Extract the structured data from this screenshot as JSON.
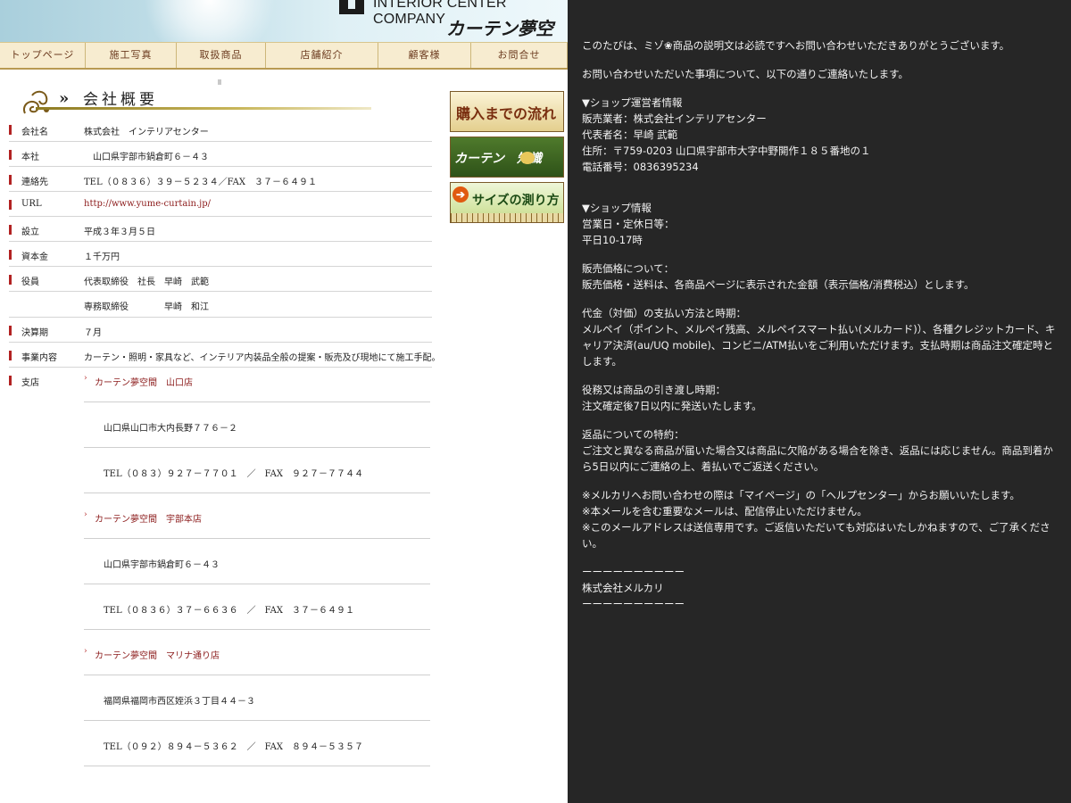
{
  "header": {
    "company_en": "INTERIOR CENTER COMPANY",
    "company_jp": "カーテン夢空間"
  },
  "nav": {
    "items": [
      {
        "label": "トップページ",
        "width": 96
      },
      {
        "label": "施工写真",
        "width": 102
      },
      {
        "label": "取扱商品",
        "width": 100
      },
      {
        "label": "店舗紹介",
        "width": 126
      },
      {
        "label": "顧客様",
        "width": 104
      },
      {
        "label": "お問合せ",
        "width": 108
      }
    ]
  },
  "company": {
    "title": "会社概要",
    "rows": [
      {
        "label": "会社名",
        "value": "株式会社　インテリアセンター"
      },
      {
        "label": "本社",
        "value": "　山口県宇部市鍋倉町６－４３"
      },
      {
        "label": "連絡先",
        "value": "TEL（０８３６）３９－５２３４／FAX　３７－６４９１"
      },
      {
        "label": "URL",
        "value": "http://www.yume-curtain.jp/"
      },
      {
        "label": "設立",
        "value": "平成３年３月５日"
      },
      {
        "label": "資本金",
        "value": "１千万円"
      },
      {
        "label": "役員",
        "value": "代表取締役　社長　早崎　武範"
      },
      {
        "label": "",
        "value": "専務取締役　　　　早崎　和江"
      },
      {
        "label": "決算期",
        "value": "７月"
      },
      {
        "label": "事業内容",
        "value": "カーテン・照明・家具など、インテリア内装品全般の提案・販売及び現地にて施工手配。"
      },
      {
        "label": "支店",
        "value": ""
      }
    ],
    "branches": [
      {
        "name": "カーテン夢空間　山口店",
        "address": "山口県山口市大内長野７７６－２",
        "contact": "TEL（０８３）９２７－７７０１　／　FAX　９２７－７７４４"
      },
      {
        "name": "カーテン夢空間　宇部本店",
        "address": "山口県宇部市鍋倉町６－４３",
        "contact": "TEL（０８３６）３７－６６３６　／　FAX　３７－６４９１"
      },
      {
        "name": "カーテン夢空間　マリナ通り店",
        "address": "福岡県福岡市西区姪浜３丁目４４－３",
        "contact": "TEL（０９２）８９４－５３６２　／　FAX　８９４－５３５７"
      }
    ]
  },
  "banners": {
    "flow": "購入までの流れ",
    "knowledge": "カーテン　知識",
    "measure": "サイズの測り方"
  },
  "message": {
    "greeting": "このたびは、ミゾ❀商品の説明文は必読ですへお問い合わせいただきありがとうございます。",
    "intro": "お問い合わせいただいた事項について、以下の通りご連絡いたします。",
    "operator_heading": "▼ショップ運営者情報",
    "operator_seller": "販売業者：株式会社インテリアセンター",
    "operator_rep": "代表者名：早崎 武範",
    "operator_address": "住所：〒759-0203 山口県宇部市大字中野開作１８５番地の１",
    "operator_phone": "電話番号：0836395234",
    "shop_heading": "▼ショップ情報",
    "shop_hours_label": "営業日・定休日等：",
    "shop_hours": "平日10-17時",
    "price_label": "販売価格について：",
    "price_text": "販売価格・送料は、各商品ページに表示された金額（表示価格/消費税込）とします。",
    "payment_label": "代金（対価）の支払い方法と時期：",
    "payment_text": "メルペイ（ポイント、メルペイ残高、メルペイスマート払い(メルカード)）、各種クレジットカード、キャリア決済(au/UQ mobile)、コンビニ/ATM払いをご利用いただけます。支払時期は商品注文確定時とします。",
    "delivery_label": "役務又は商品の引き渡し時期：",
    "delivery_text": "注文確定後7日以内に発送いたします。",
    "return_label": "返品についての特約：",
    "return_text": "ご注文と異なる商品が届いた場合又は商品に欠陥がある場合を除き、返品には応じません。商品到着から5日以内にご連絡の上、着払いでご返送ください。",
    "note1": "※メルカリへお問い合わせの際は「マイページ」の「ヘルプセンター」からお願いいたします。",
    "note2": "※本メールを含む重要なメールは、配信停止いただけません。",
    "note3": "※このメールアドレスは送信専用です。ご返信いただいても対応はいたしかねますので、ご了承ください。",
    "divider": "ーーーーーーーーーー",
    "signature": "株式会社メルカリ"
  },
  "colors": {
    "panel_bg": "#262626",
    "nav_bg": "#f7ecd0",
    "accent_red": "#b22222"
  }
}
